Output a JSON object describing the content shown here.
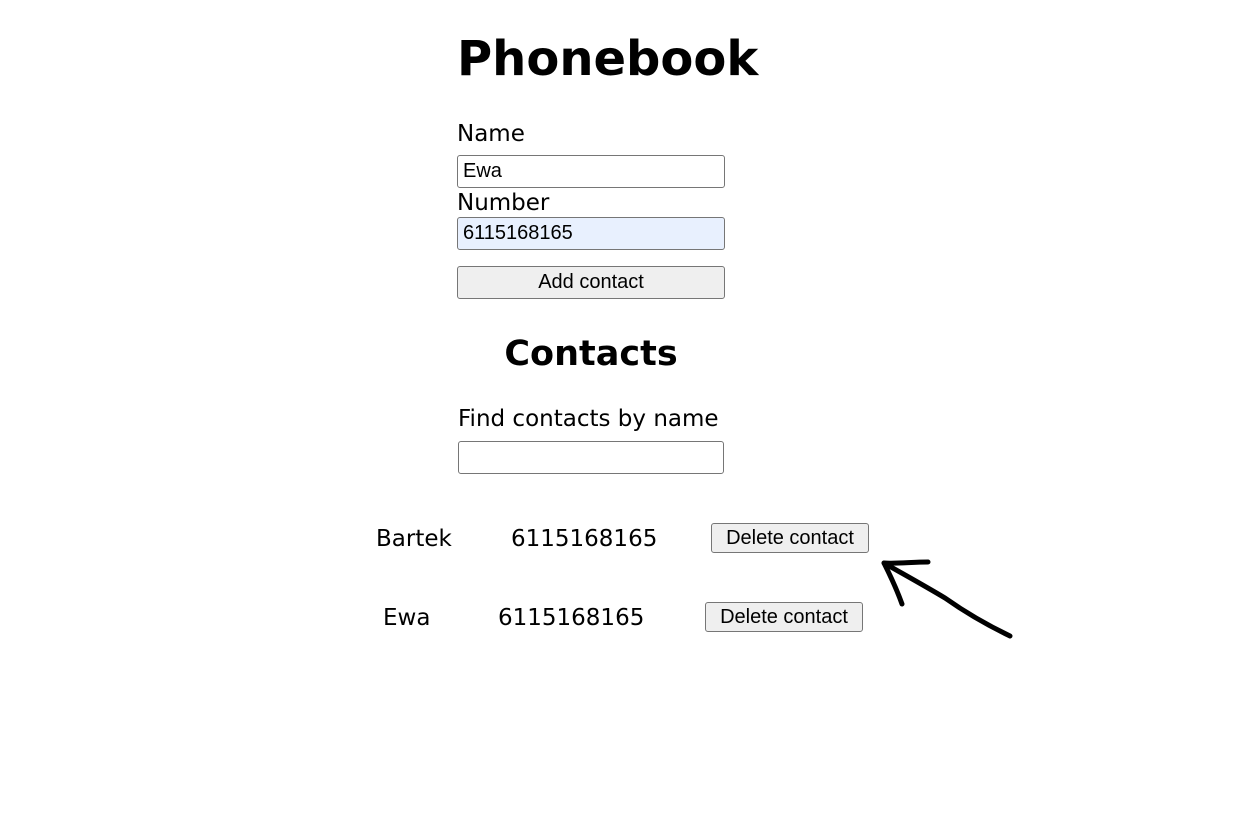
{
  "app": {
    "title": "Phonebook"
  },
  "form": {
    "name_label": "Name",
    "name_value": "Ewa",
    "number_label": "Number",
    "number_value": "6115168165",
    "add_button_label": "Add contact"
  },
  "contacts": {
    "heading": "Contacts",
    "filter_label": "Find contacts by name",
    "filter_value": "",
    "items": [
      {
        "name": "Bartek",
        "number": "6115168165",
        "delete_label": "Delete contact"
      },
      {
        "name": "Ewa",
        "number": "6115168165",
        "delete_label": "Delete contact"
      }
    ]
  },
  "annotation": {
    "icon": "hand-drawn-arrow-icon",
    "color": "#000000"
  }
}
